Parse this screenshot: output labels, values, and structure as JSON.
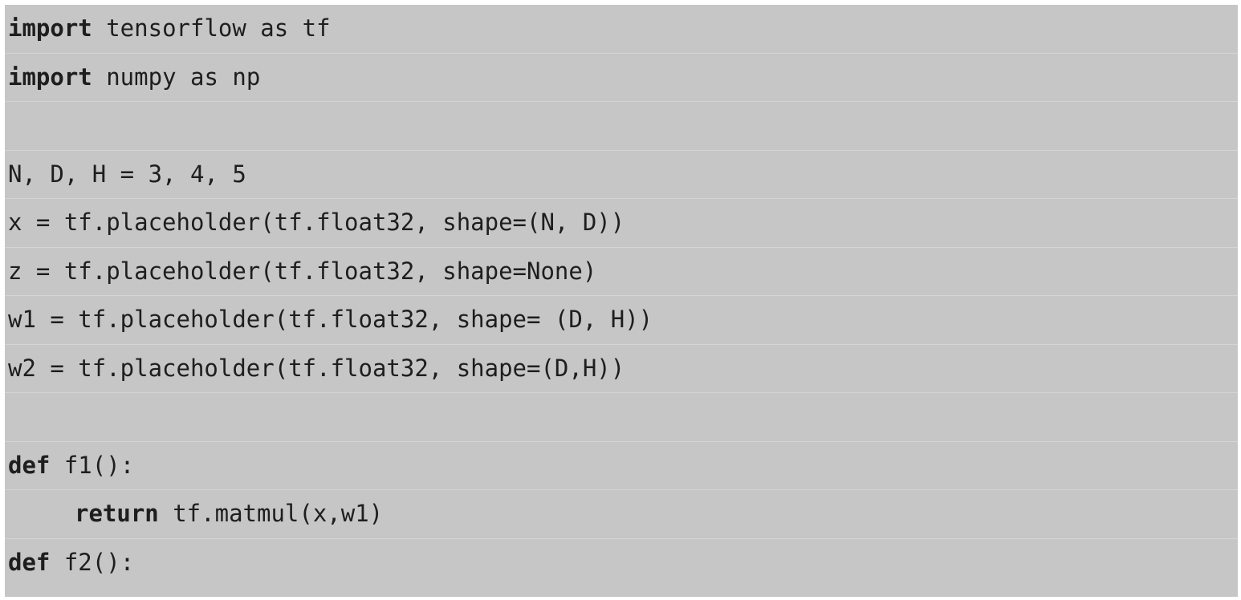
{
  "code": {
    "language": "python",
    "lines": [
      {
        "keyword": "import",
        "rest": " tensorflow as tf"
      },
      {
        "keyword": "import",
        "rest": " numpy as np"
      },
      {
        "keyword": "",
        "rest": ""
      },
      {
        "keyword": "",
        "rest": "N, D, H = 3, 4, 5"
      },
      {
        "keyword": "",
        "rest": "x = tf.placeholder(tf.float32, shape=(N, D))"
      },
      {
        "keyword": "",
        "rest": "z = tf.placeholder(tf.float32, shape=None)"
      },
      {
        "keyword": "",
        "rest": "w1 = tf.placeholder(tf.float32, shape= (D, H))"
      },
      {
        "keyword": "",
        "rest": "w2 = tf.placeholder(tf.float32, shape=(D,H))"
      },
      {
        "keyword": "",
        "rest": ""
      },
      {
        "keyword": "def",
        "rest": " f1():"
      },
      {
        "keyword": "return",
        "rest": " tf.matmul(x,w1)"
      },
      {
        "keyword": "def",
        "rest": " f2():"
      }
    ]
  }
}
